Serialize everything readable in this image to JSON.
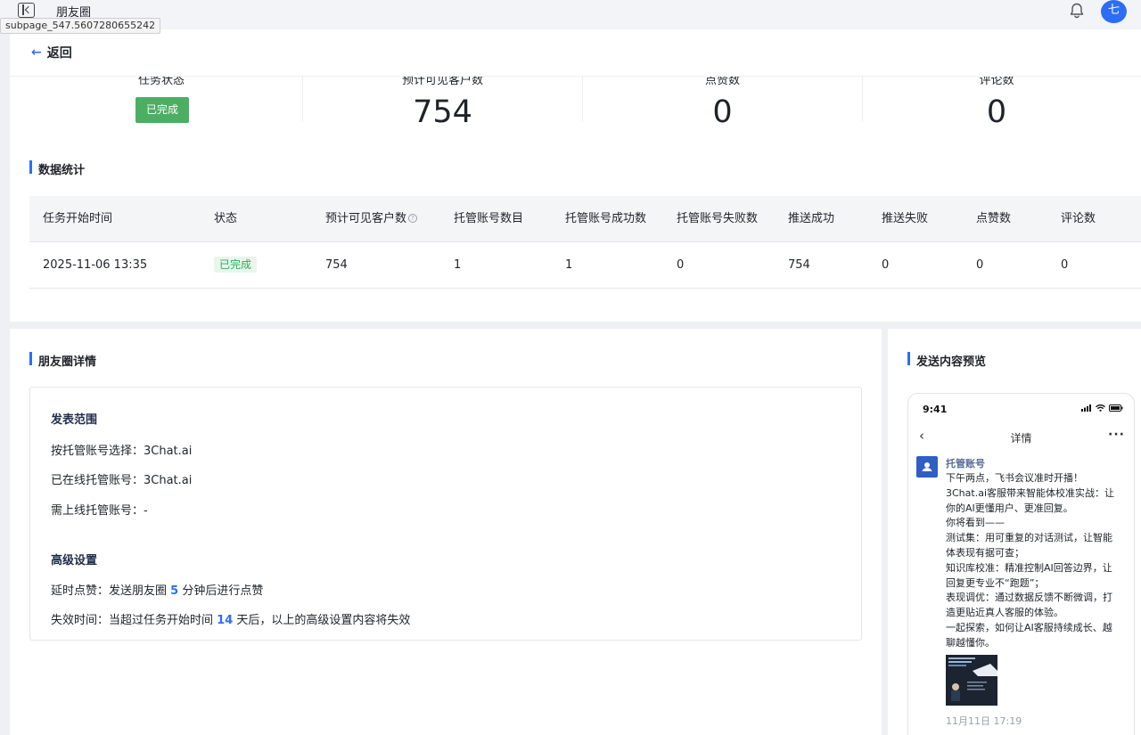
{
  "topbar": {
    "title": "朋友圈",
    "tooltip": "subpage_547.5607280655242",
    "avatar_initial": "七"
  },
  "back_label": "返回",
  "stats": [
    {
      "label": "任务状态",
      "value": "已完成"
    },
    {
      "label": "预计可见客户数",
      "value": "754"
    },
    {
      "label": "点赞数",
      "value": "0"
    },
    {
      "label": "评论数",
      "value": "0"
    }
  ],
  "data_section_title": "数据统计",
  "table": {
    "headers": [
      "任务开始时间",
      "状态",
      "预计可见客户数",
      "托管账号数目",
      "托管账号成功数",
      "托管账号失败数",
      "推送成功",
      "推送失败",
      "点赞数",
      "评论数"
    ],
    "row": [
      "2025-11-06 13:35",
      "已完成",
      "754",
      "1",
      "1",
      "0",
      "754",
      "0",
      "0",
      "0"
    ]
  },
  "detail": {
    "section_title": "朋友圈详情",
    "scope_title": "发表范围",
    "scope_by_account": "按托管账号选择：3Chat.ai",
    "online_accounts": "已在线托管账号：3Chat.ai",
    "need_online": "需上线托管账号：-",
    "advanced_title": "高级设置",
    "delay_like_prefix": "延时点赞：发送朋友圈",
    "delay_like_value": "5",
    "delay_like_suffix": "分钟后进行点赞",
    "expire_prefix": "失效时间：当超过任务开始时间",
    "expire_value": "14",
    "expire_suffix": "天后，以上的高级设置内容将失效"
  },
  "preview": {
    "section_title": "发送内容预览",
    "time": "9:41",
    "nav_title": "详情",
    "author": "托管账号",
    "body_lines": [
      "下午两点，飞书会议准时开播！",
      "3Chat.ai客服带来智能体校准实战：让",
      "你的AI更懂用户、更准回复。",
      "你将看到——",
      "测试集：用可重复的对话测试，让智能",
      "体表现有据可查；",
      "知识库校准：精准控制AI回答边界，让",
      "回复更专业不“跑题”；",
      "表现调优：通过数据反馈不断微调，打",
      "造更贴近真人客服的体验。",
      " 一起探索，如何让AI客服持续成长、越",
      "聊越懂你。"
    ],
    "post_time": "11月11日 17:19"
  }
}
